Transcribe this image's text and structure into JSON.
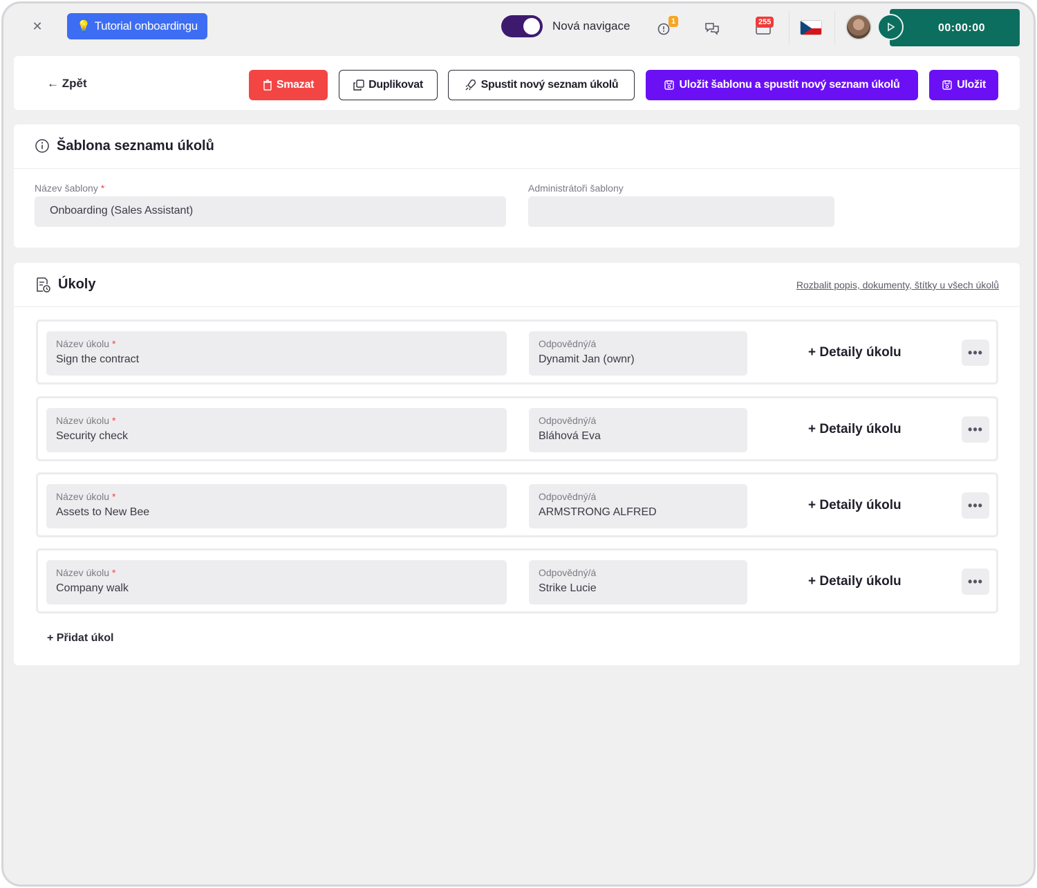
{
  "topbar": {
    "close_icon": "close-icon",
    "tutorial_label": "Tutorial onboardingu",
    "toggle_label": "Nová navigace",
    "toggle_on": true,
    "notifications_badge": "1",
    "messages_badge": "255",
    "timer": "00:00:00",
    "colors": {
      "tutorial_bg": "#3d6df2",
      "toggle_bg": "#3d1a6e",
      "timer_bg": "#0c6e5e"
    }
  },
  "actions": {
    "back_label": "Zpět",
    "delete_label": "Smazat",
    "duplicate_label": "Duplikovat",
    "start_label": "Spustit nový seznam úkolů",
    "save_start_label": "Uložit šablonu a spustit nový seznam úkolů",
    "save_label": "Uložit",
    "colors": {
      "delete": "#f44545",
      "primary": "#6b10f5"
    }
  },
  "template": {
    "title": "Šablona seznamu úkolů",
    "name_label": "Název šablony",
    "name_value": "Onboarding (Sales Assistant)",
    "admins_label": "Administrátoři šablony",
    "admins_value": ""
  },
  "tasks": {
    "title": "Úkoly",
    "expand_link": "Rozbalit popis, dokumenty, štítky u všech úkolů",
    "name_label": "Název úkolu",
    "owner_label": "Odpovědný/á",
    "detail_label": "+ Detaily úkolu",
    "items": [
      {
        "name": "Sign the contract",
        "owner": "Dynamit Jan (ownr)"
      },
      {
        "name": "Security check",
        "owner": "Bláhová Eva"
      },
      {
        "name": "Assets to New Bee",
        "owner": "ARMSTRONG ALFRED"
      },
      {
        "name": "Company walk",
        "owner": "Strike Lucie"
      }
    ],
    "add_label": "Přidat úkol"
  }
}
